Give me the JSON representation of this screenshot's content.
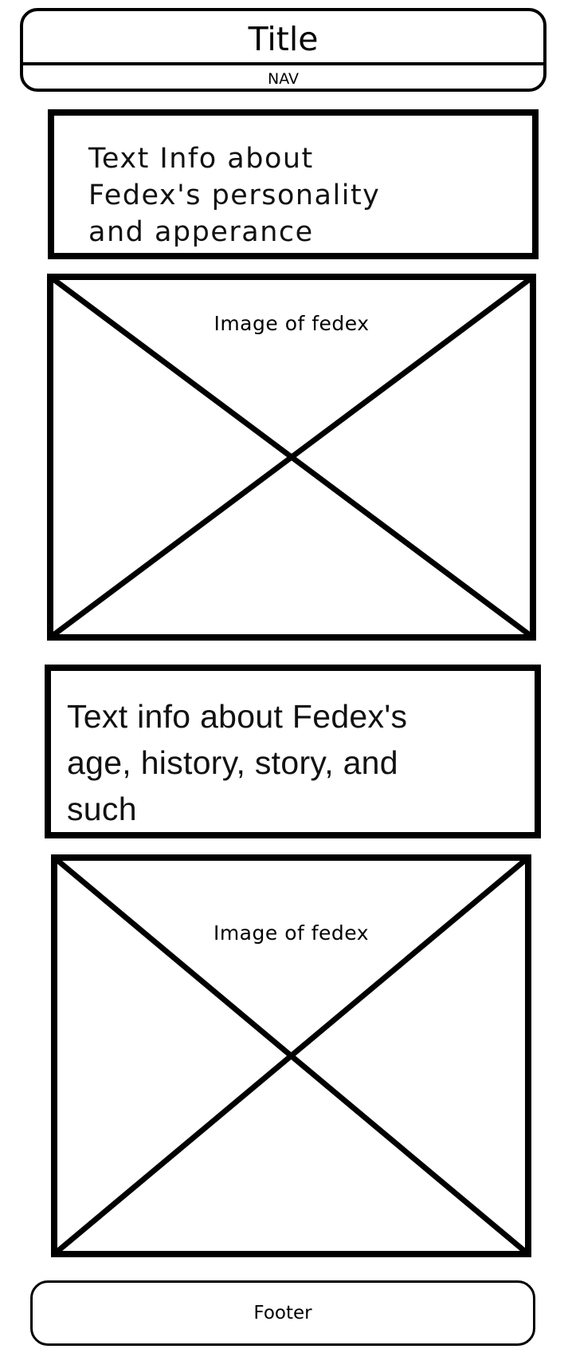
{
  "header": {
    "title": "Title",
    "nav": "NAV"
  },
  "sections": [
    {
      "text": "Text Info about\nFedex's personality\nand apperance"
    },
    {
      "image_caption": "Image of fedex"
    },
    {
      "text": "Text info about Fedex's\nage, history, story, and\nsuch"
    },
    {
      "image_caption": "Image of fedex"
    }
  ],
  "footer": {
    "label": "Footer"
  }
}
